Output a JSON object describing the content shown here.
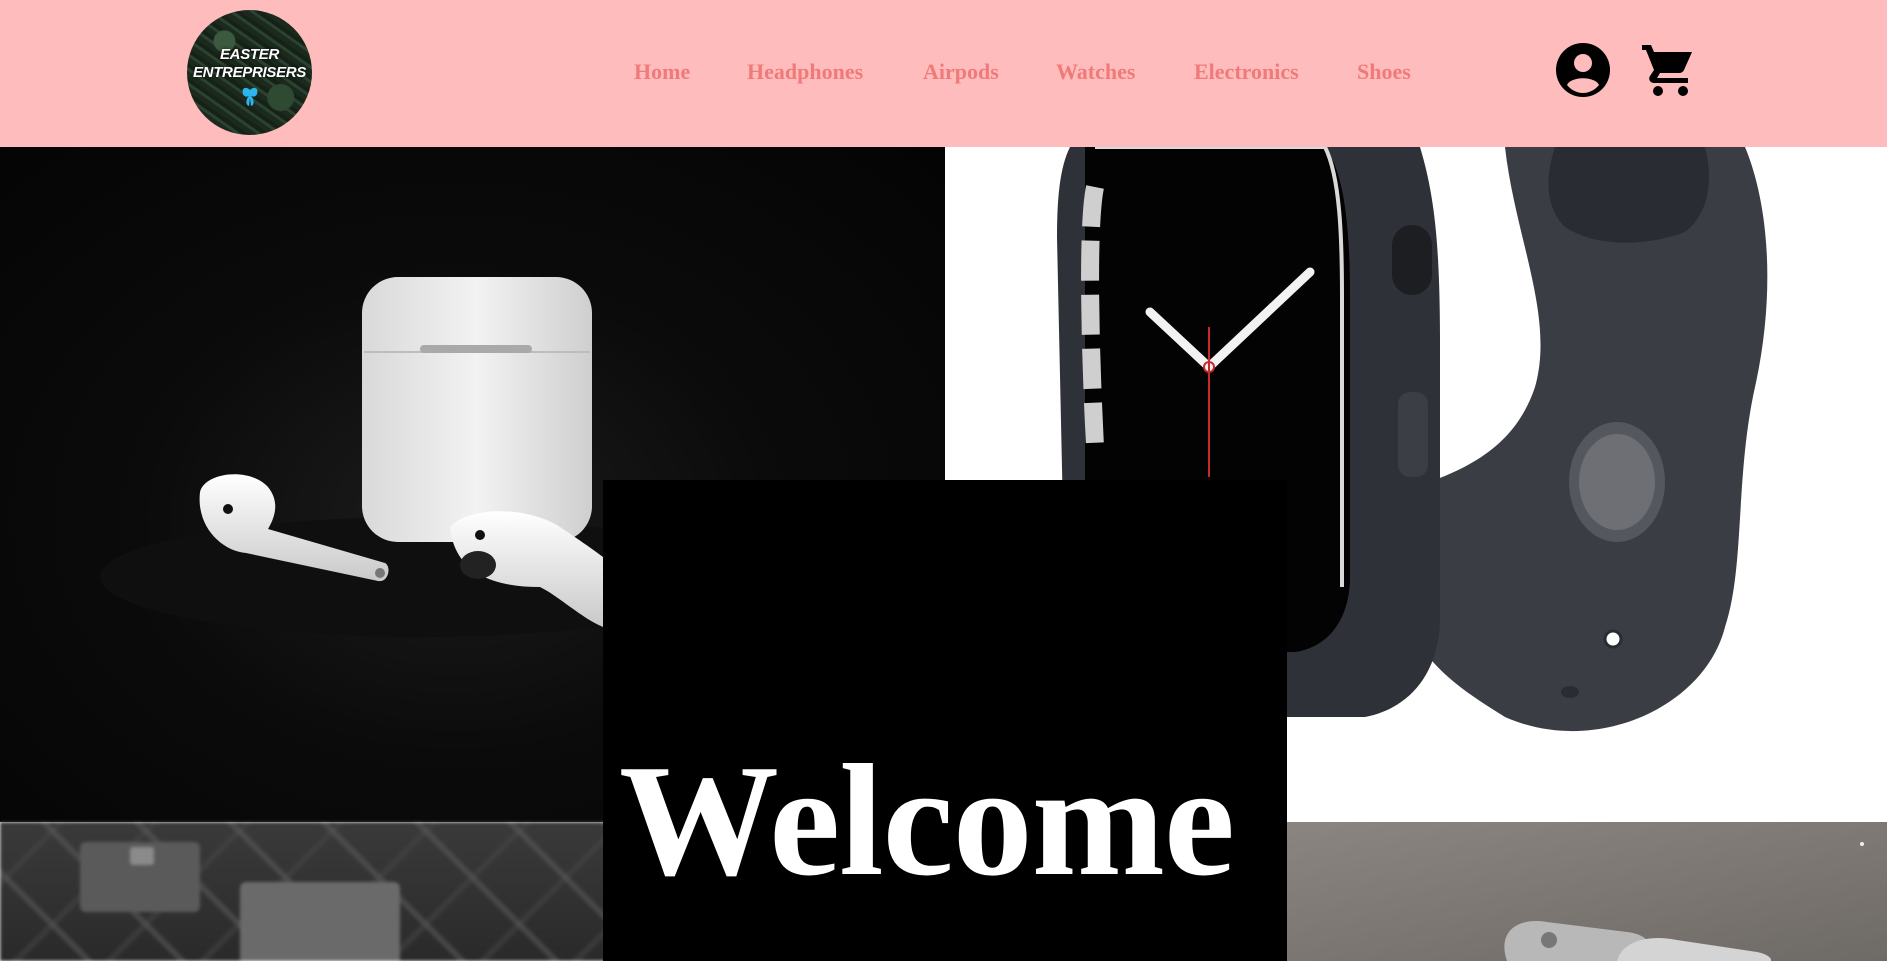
{
  "brand": {
    "logo_lines": [
      "EASTER",
      "ENTREPRISERS"
    ],
    "colors": {
      "header_bg": "#ffbcbc",
      "nav_text": "#f07a7a",
      "icon": "#000000"
    }
  },
  "nav": {
    "items": [
      {
        "label": "Home"
      },
      {
        "label": "Headphones"
      },
      {
        "label": "Airpods"
      },
      {
        "label": "Watches"
      },
      {
        "label": "Electronics"
      },
      {
        "label": "Shoes"
      }
    ]
  },
  "header_icons": {
    "account": "account-circle-icon",
    "cart": "shopping-cart-icon"
  },
  "hero": {
    "welcome": "Welcome",
    "tiles": [
      "airpods-photo",
      "apple-watch-photo",
      "keyboard-photo",
      "keys-photo"
    ]
  }
}
